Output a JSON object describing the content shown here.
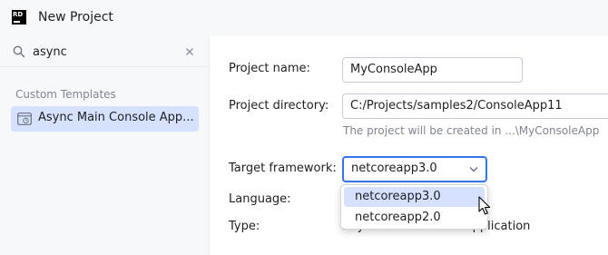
{
  "window": {
    "title": "New Project",
    "logo_text": "RD"
  },
  "search": {
    "value": "async",
    "placeholder": ""
  },
  "sidebar": {
    "section_title": "Custom Templates",
    "items": [
      {
        "label": "Async Main Console App...",
        "selected": true
      }
    ]
  },
  "form": {
    "project_name_label": "Project name:",
    "project_name_value": "MyConsoleApp",
    "project_directory_label": "Project directory:",
    "project_directory_value": "C:/Projects/samples2/ConsoleApp11",
    "project_hint": "The project will be created in ...\\MyConsoleApp",
    "target_framework_label": "Target framework:",
    "target_framework_value": "netcoreapp3.0",
    "language_label": "Language:",
    "type_label": "Type:",
    "type_value": "Async Main Console Application"
  },
  "dropdown": {
    "options": [
      {
        "label": "netcoreapp3.0",
        "highlighted": true
      },
      {
        "label": "netcoreapp2.0",
        "highlighted": false
      }
    ]
  },
  "colors": {
    "accent": "#3574f0",
    "selection": "#d5e1ff",
    "muted_text": "#818594"
  }
}
